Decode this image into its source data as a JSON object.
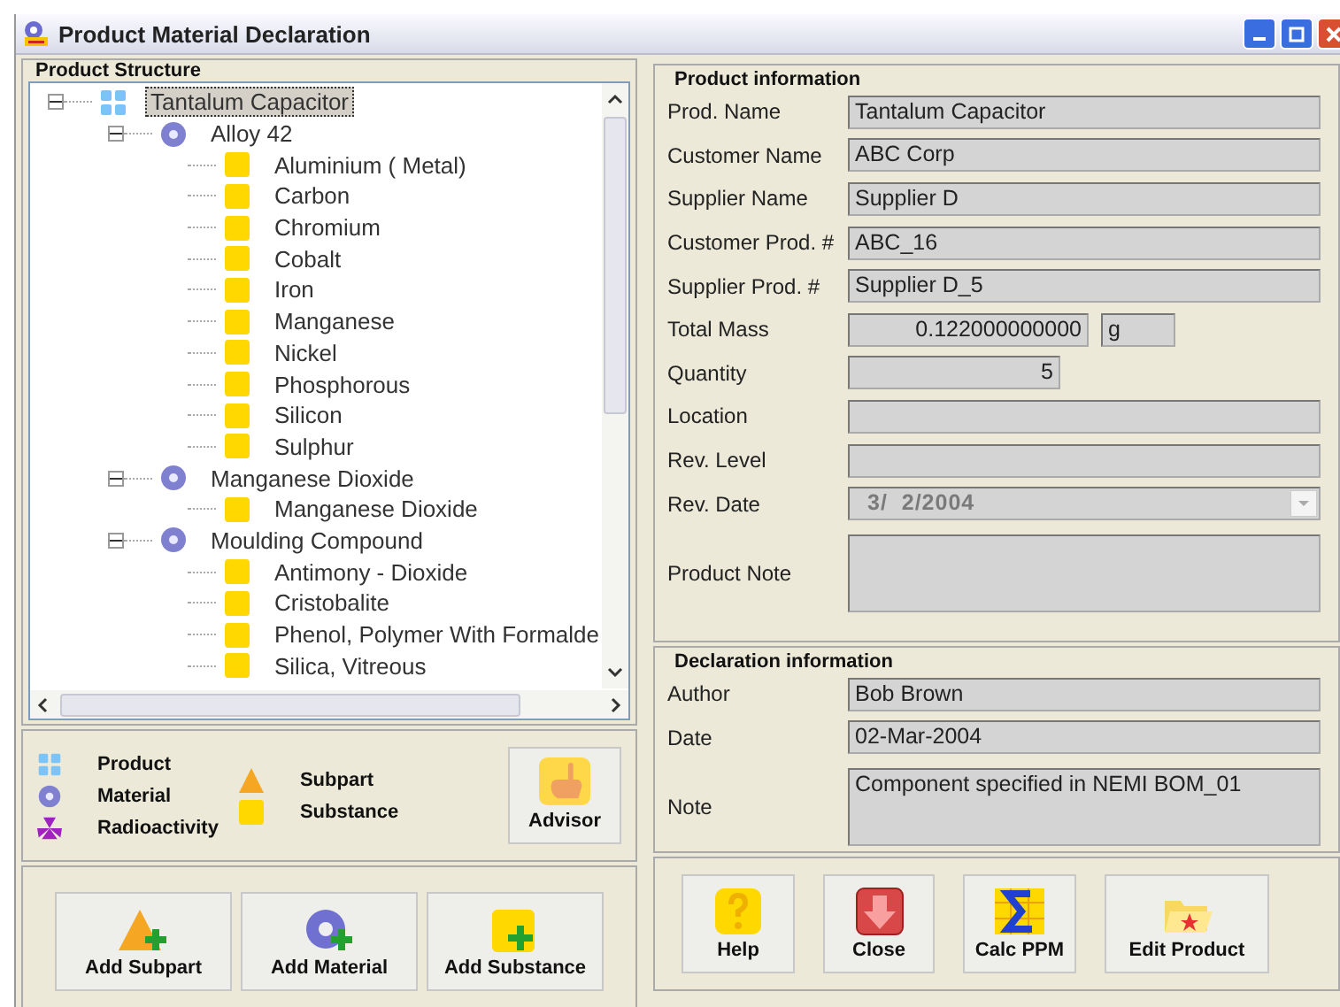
{
  "window": {
    "title": "Product Material Declaration"
  },
  "product_structure": {
    "title": "Product Structure",
    "tree": [
      {
        "label": "Tantalum Capacitor",
        "kind": "product",
        "expanded": true,
        "selected": true,
        "children": [
          {
            "label": "Alloy 42",
            "kind": "material",
            "expanded": true,
            "selected": false,
            "children": [
              {
                "label": "Aluminium ( Metal)",
                "kind": "substance",
                "selected": false
              },
              {
                "label": "Carbon",
                "kind": "substance",
                "selected": false
              },
              {
                "label": "Chromium",
                "kind": "substance",
                "selected": false
              },
              {
                "label": "Cobalt",
                "kind": "substance",
                "selected": false
              },
              {
                "label": "Iron",
                "kind": "substance",
                "selected": false
              },
              {
                "label": "Manganese",
                "kind": "substance",
                "selected": false
              },
              {
                "label": "Nickel",
                "kind": "substance",
                "selected": false
              },
              {
                "label": "Phosphorous",
                "kind": "substance",
                "selected": false
              },
              {
                "label": "Silicon",
                "kind": "substance",
                "selected": false
              },
              {
                "label": "Sulphur",
                "kind": "substance",
                "selected": false
              }
            ]
          },
          {
            "label": "Manganese Dioxide",
            "kind": "material",
            "expanded": true,
            "selected": false,
            "children": [
              {
                "label": "Manganese Dioxide",
                "kind": "substance",
                "selected": false
              }
            ]
          },
          {
            "label": "Moulding Compound",
            "kind": "material",
            "expanded": true,
            "selected": false,
            "children": [
              {
                "label": "Antimony - Dioxide",
                "kind": "substance",
                "selected": false
              },
              {
                "label": "Cristobalite",
                "kind": "substance",
                "selected": false
              },
              {
                "label": "Phenol, Polymer With Formalde",
                "kind": "substance",
                "selected": false
              },
              {
                "label": "Silica, Vitreous",
                "kind": "substance",
                "selected": false
              }
            ]
          }
        ]
      }
    ]
  },
  "legend": [
    {
      "label": "Product",
      "kind": "product"
    },
    {
      "label": "Material",
      "kind": "material"
    },
    {
      "label": "Radioactivity",
      "kind": "radioactivity"
    },
    {
      "label": "Subpart",
      "kind": "subpart"
    },
    {
      "label": "Substance",
      "kind": "substance"
    }
  ],
  "advisor_button": {
    "label": "Advisor"
  },
  "add_buttons": [
    {
      "label": "Add Subpart",
      "kind": "subpart"
    },
    {
      "label": "Add Material",
      "kind": "material"
    },
    {
      "label": "Add Substance",
      "kind": "substance"
    }
  ],
  "product_information": {
    "title": "Product information",
    "fields": [
      {
        "label": "Prod. Name",
        "value": "Tantalum Capacitor",
        "kind": "text"
      },
      {
        "label": "Customer Name",
        "value": "ABC Corp",
        "kind": "text"
      },
      {
        "label": "Supplier Name",
        "value": "Supplier D",
        "kind": "text"
      },
      {
        "label": "Customer Prod. #",
        "value": "ABC_16",
        "kind": "text"
      },
      {
        "label": "Supplier Prod. #",
        "value": "Supplier D_5",
        "kind": "text"
      },
      {
        "label": "Total Mass",
        "value": "0.122000000000",
        "unit": "g",
        "kind": "mass"
      },
      {
        "label": "Quantity",
        "value": "5",
        "kind": "number"
      },
      {
        "label": "Location",
        "kind": "text"
      },
      {
        "label": "Rev. Level",
        "kind": "text"
      },
      {
        "label": "Rev. Date",
        "value": "3/  2/2004",
        "kind": "date",
        "disabled": true
      },
      {
        "label": "Product Note",
        "kind": "note"
      }
    ]
  },
  "declaration_information": {
    "title": "Declaration information",
    "fields": [
      {
        "label": "Author",
        "value": "Bob Brown",
        "kind": "text"
      },
      {
        "label": "Date",
        "value": "02-Mar-2004",
        "kind": "text"
      },
      {
        "label": "Note",
        "value": "Component specified in NEMI BOM_01",
        "kind": "note"
      }
    ]
  },
  "action_buttons": [
    {
      "label": "Help",
      "kind": "help"
    },
    {
      "label": "Close",
      "kind": "close"
    },
    {
      "label": "Calc PPM",
      "kind": "calc"
    },
    {
      "label": "Edit Product",
      "kind": "edit"
    }
  ]
}
